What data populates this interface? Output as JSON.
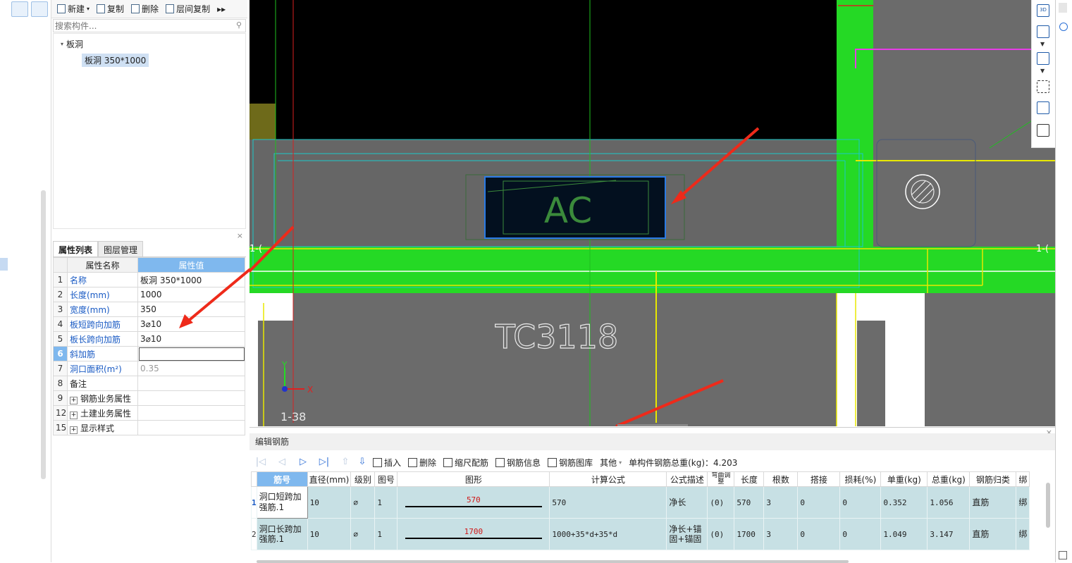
{
  "toolbar": {
    "new_label": "新建",
    "copy_label": "复制",
    "delete_label": "删除",
    "floor_copy_label": "层间复制",
    "more": "▸▸"
  },
  "search": {
    "placeholder": "搜索构件..."
  },
  "tree": {
    "group_label": "板洞",
    "leaf_label": "板洞 350*1000"
  },
  "props": {
    "tab_active": "属性列表",
    "tab_other": "图层管理",
    "col_name": "属性名称",
    "col_value": "属性值",
    "rows": [
      {
        "num": "1",
        "name": "名称",
        "value": "板洞 350*1000"
      },
      {
        "num": "2",
        "name": "长度(mm)",
        "value": "1000"
      },
      {
        "num": "3",
        "name": "宽度(mm)",
        "value": "350"
      },
      {
        "num": "4",
        "name": "板短跨向加筋",
        "value": "3⌀10"
      },
      {
        "num": "5",
        "name": "板长跨向加筋",
        "value": "3⌀10"
      },
      {
        "num": "6",
        "name": "斜加筋",
        "value": ""
      },
      {
        "num": "7",
        "name": "洞口面积(m²)",
        "value": "0.35"
      },
      {
        "num": "8",
        "name": "备注",
        "value": ""
      },
      {
        "num": "9",
        "name": "钢筋业务属性",
        "value": ""
      },
      {
        "num": "12",
        "name": "土建业务属性",
        "value": ""
      },
      {
        "num": "15",
        "name": "显示样式",
        "value": ""
      }
    ]
  },
  "cad": {
    "opening_label": "AC",
    "window_label": "TC3118",
    "axis_label_left": "1-(",
    "axis_label_right": "1-(",
    "grid_label": "1-38",
    "y_axis": "Y",
    "x_axis": "X",
    "colors": {
      "wall_green": "#25d925",
      "slab_gray": "#6b6b6b",
      "cyan": "#1cc8c8",
      "yellow": "#e8e800",
      "magenta": "#e63ce6",
      "arrow": "#ee2a1a"
    }
  },
  "editor": {
    "title": "编辑钢筋",
    "insert": "插入",
    "delete": "删除",
    "scale_rebar": "缩尺配筋",
    "rebar_info": "钢筋信息",
    "rebar_lib": "钢筋图库",
    "other": "其他",
    "total_weight": "单构件钢筋总重(kg)：4.203",
    "columns": [
      "筋号",
      "直径(mm)",
      "级别",
      "图号",
      "图形",
      "计算公式",
      "公式描述",
      "弯曲调整",
      "长度",
      "根数",
      "搭接",
      "损耗(%)",
      "单重(kg)",
      "总重(kg)",
      "钢筋归类",
      "绑"
    ],
    "rows": [
      {
        "idx": "1",
        "name": "洞口短跨加强筋.1",
        "dia": "10",
        "grade": "⌀",
        "fig": "1",
        "shape": "570",
        "formula": "570",
        "desc": "净长",
        "bend": "(0)",
        "length": "570",
        "count": "3",
        "lap": "0",
        "loss": "0",
        "unit_w": "0.352",
        "total_w": "1.056",
        "category": "直筋",
        "bind": "绑"
      },
      {
        "idx": "2",
        "name": "洞口长跨加强筋.1",
        "dia": "10",
        "grade": "⌀",
        "fig": "1",
        "shape": "1700",
        "formula": "1000+35*d+35*d",
        "desc": "净长+锚固+锚固",
        "bend": "(0)",
        "length": "1700",
        "count": "3",
        "lap": "0",
        "loss": "0",
        "unit_w": "1.049",
        "total_w": "3.147",
        "category": "直筋",
        "bind": "绑"
      }
    ]
  }
}
